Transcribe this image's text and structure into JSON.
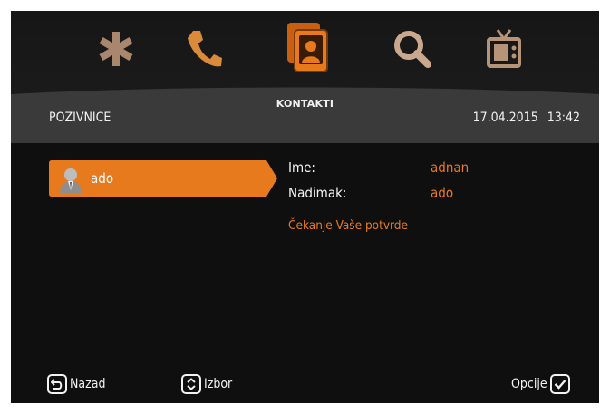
{
  "dock": {
    "active_label": "KONTAKTI",
    "icons": [
      "settings-icon",
      "phone-icon",
      "contacts-icon",
      "search-icon",
      "tv-icon"
    ]
  },
  "header": {
    "title": "POZIVNICE",
    "date": "17.04.2015",
    "time": "13:42"
  },
  "list": {
    "selected_contact": "ado"
  },
  "details": {
    "name_label": "Ime:",
    "name_value": "adnan",
    "nickname_label": "Nadimak:",
    "nickname_value": "ado",
    "status": "Čekanje Vaše potvrde"
  },
  "footer": {
    "back_label": "Nazad",
    "select_label": "Izbor",
    "options_label": "Opcije"
  },
  "colors": {
    "accent": "#e87a1e",
    "background": "#0f0f0f",
    "band": "#3a3a3a"
  }
}
